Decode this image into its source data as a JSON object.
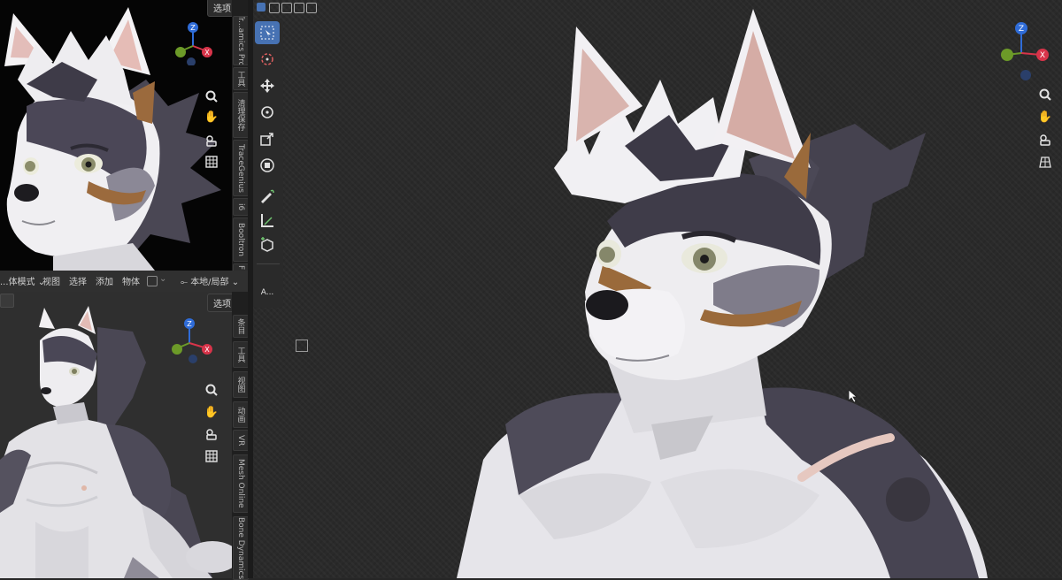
{
  "top_left_view": {
    "options_label": "选项",
    "n_panel_tabs": [
      "Tr...amics Pro",
      "工具",
      "清理保存",
      "TraceGenius",
      "i6",
      "Booltron",
      "F"
    ]
  },
  "mid_header": {
    "mode_label": "...体模式",
    "menu": [
      "视图",
      "选择",
      "添加",
      "物体"
    ],
    "transform_orientation": "本地/局部"
  },
  "bottom_left_view": {
    "options_label": "选项",
    "n_panel_tabs": [
      "条目",
      "工具",
      "视图",
      "动画",
      "VR",
      "Mesh Online",
      "Bone Dynamics"
    ]
  },
  "main_view": {
    "toolbar_tools": [
      "select-box",
      "cursor",
      "move",
      "rotate",
      "scale",
      "transform",
      "annotate",
      "measure",
      "add-cube"
    ],
    "text_tool_label": "A...",
    "nav_icons": [
      "zoom-icon",
      "hand-icon",
      "camera-icon",
      "grid-icon"
    ]
  },
  "gizmo": {
    "x_label": "X",
    "y_label": "Y",
    "z_label": "Z",
    "x_color": "#d8344a",
    "y_color": "#6c9a28",
    "z_color": "#2f6cd8"
  },
  "colors": {
    "active_tool": "#4772b3",
    "viewport_bg": "#2a2a2a",
    "header_bg": "#303030"
  }
}
